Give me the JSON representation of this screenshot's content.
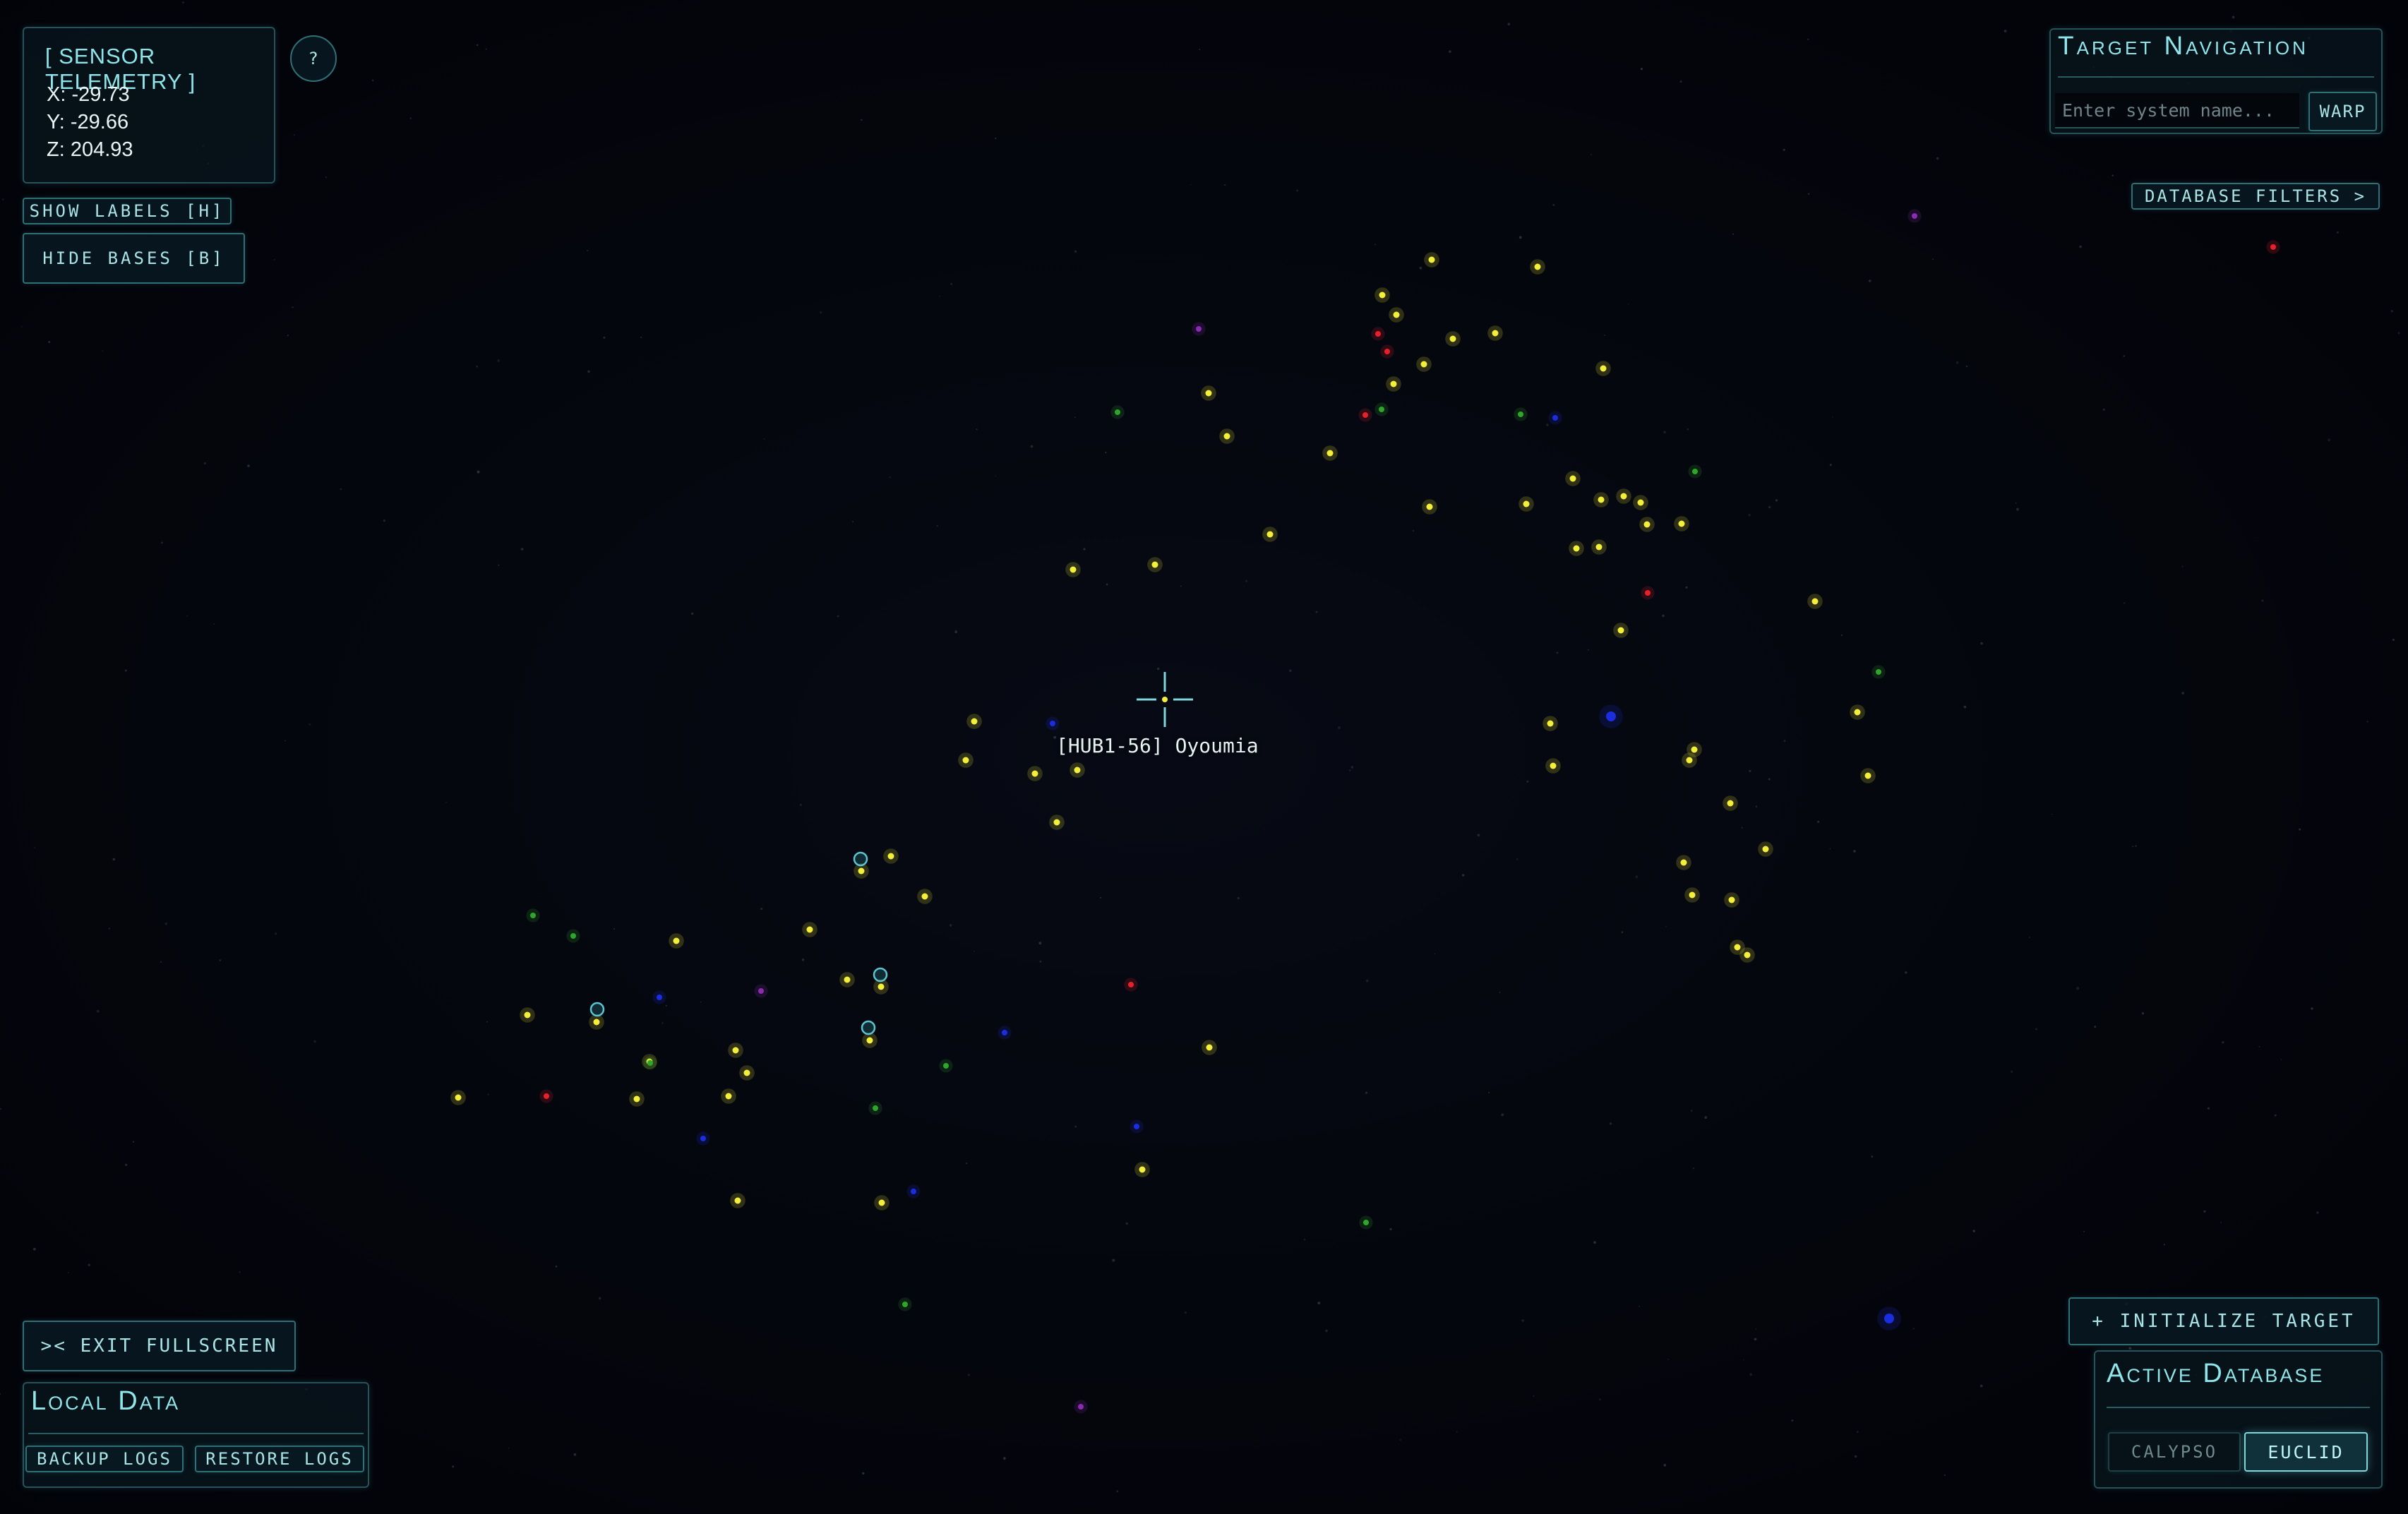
{
  "telemetry": {
    "title": "[ SENSOR TELEMETRY ]",
    "x": "X: -29.73",
    "y": "Y: -29.66",
    "z": "Z: 204.93"
  },
  "help": {
    "label": "?"
  },
  "toggles": {
    "show_labels": "SHOW LABELS [H]",
    "hide_bases": "HIDE BASES [B]"
  },
  "target_nav": {
    "title": "Target Navigation",
    "input_placeholder": "Enter system name...",
    "input_value": "",
    "warp": "WARP"
  },
  "filters": {
    "label": "DATABASE FILTERS >"
  },
  "target": {
    "label": "[HUB1-56] Oyoumia"
  },
  "fullscreen": {
    "label": ">< EXIT FULLSCREEN"
  },
  "local_data": {
    "title": "Local Data",
    "backup": "BACKUP LOGS",
    "restore": "RESTORE LOGS"
  },
  "actions": {
    "init_target": "+ INITIALIZE TARGET"
  },
  "active_db": {
    "title": "Active Database",
    "options": [
      "CALYPSO",
      "EUCLID"
    ],
    "selected": "EUCLID"
  },
  "colors": {
    "accent": "#8fe6ea",
    "panel_border": "#27525a",
    "star_yellow": "#f3ef3a",
    "star_red": "#e8202a",
    "star_blue": "#1a2ee0",
    "star_green": "#2fa52c",
    "star_purple": "#8a2cb0",
    "base_marker": "#58c7cf"
  }
}
